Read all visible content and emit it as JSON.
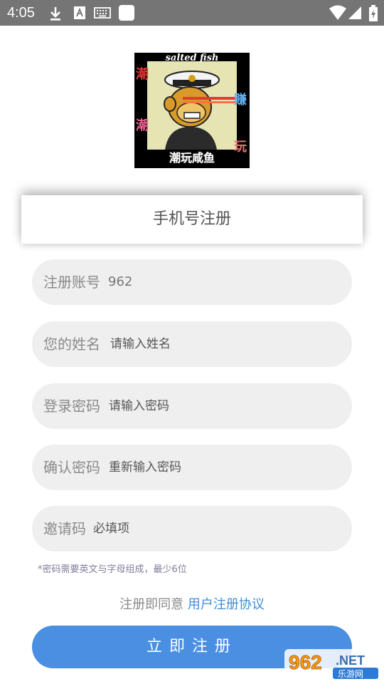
{
  "status_bar": {
    "time": "4:05",
    "left_icons": [
      "download-icon",
      "font-icon",
      "keyboard-icon",
      "app-icon"
    ],
    "right_icons": [
      "wifi-icon",
      "signal-icon",
      "battery-charging-icon"
    ]
  },
  "logo": {
    "top_text": "salted fish",
    "bottom_text": "潮玩咸鱼",
    "side_chars": [
      "潮",
      "潮",
      "赚",
      "玩"
    ]
  },
  "header": {
    "title": "手机号注册"
  },
  "form": {
    "fields": [
      {
        "label": "注册账号",
        "value": "962",
        "placeholder": ""
      },
      {
        "label": "您的姓名",
        "value": "",
        "placeholder": "请输入姓名"
      },
      {
        "label": "登录密码",
        "value": "",
        "placeholder": "请输入密码"
      },
      {
        "label": "确认密码",
        "value": "",
        "placeholder": "重新输入密码"
      },
      {
        "label": "邀请码",
        "value": "",
        "placeholder": "必填项"
      }
    ],
    "hint": "*密码需要英文与字母组成，最少6位",
    "agree_prefix": "注册即同意",
    "agree_link": "用户注册协议",
    "submit_label": "立即注册"
  },
  "watermark": {
    "brand": "962",
    "suffix": ".NET",
    "site": "乐游网"
  },
  "colors": {
    "accent": "#4a8fe1",
    "link": "#3e8ed8",
    "field_bg": "#efefef",
    "status_bar": "#757575"
  }
}
